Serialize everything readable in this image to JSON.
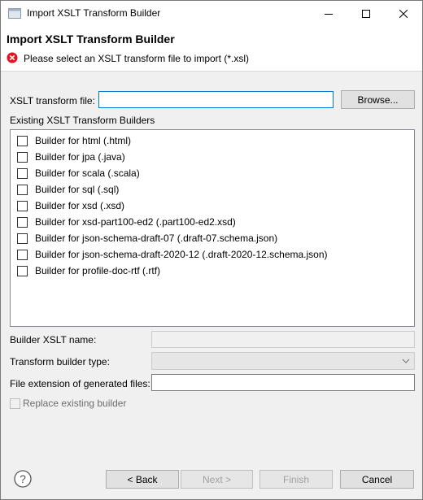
{
  "window": {
    "title": "Import XSLT Transform Builder",
    "icons": {
      "app": "window-app-icon",
      "minimize": "minimize-icon",
      "maximize": "maximize-icon",
      "close": "close-icon"
    }
  },
  "header": {
    "title": "Import XSLT Transform Builder",
    "message": "Please select an XSLT transform file to import (*.xsl)",
    "message_icon": "error-icon"
  },
  "form": {
    "xslt_file_label": "XSLT transform file:",
    "xslt_file_value": "",
    "browse_label": "Browse...",
    "existing_label": "Existing XSLT Transform Builders",
    "builders": [
      {
        "label": "Builder for html  (.html)",
        "checked": false
      },
      {
        "label": "Builder for jpa  (.java)",
        "checked": false
      },
      {
        "label": "Builder for scala  (.scala)",
        "checked": false
      },
      {
        "label": "Builder for sql  (.sql)",
        "checked": false
      },
      {
        "label": "Builder for xsd  (.xsd)",
        "checked": false
      },
      {
        "label": "Builder for xsd-part100-ed2  (.part100-ed2.xsd)",
        "checked": false
      },
      {
        "label": "Builder for json-schema-draft-07  (.draft-07.schema.json)",
        "checked": false
      },
      {
        "label": "Builder for json-schema-draft-2020-12  (.draft-2020-12.schema.json)",
        "checked": false
      },
      {
        "label": "Builder for profile-doc-rtf  (.rtf)",
        "checked": false
      }
    ],
    "builder_name_label": "Builder XSLT name:",
    "builder_name_value": "",
    "builder_type_label": "Transform builder type:",
    "builder_type_value": "",
    "file_ext_label": "File extension of generated files:",
    "file_ext_value": "",
    "replace_label": "Replace existing builder",
    "replace_checked": false
  },
  "footer": {
    "help_icon": "help-icon",
    "back_label": "< Back",
    "next_label": "Next >",
    "finish_label": "Finish",
    "cancel_label": "Cancel"
  },
  "colors": {
    "accent": "#0078d7",
    "error": "#e81123"
  }
}
